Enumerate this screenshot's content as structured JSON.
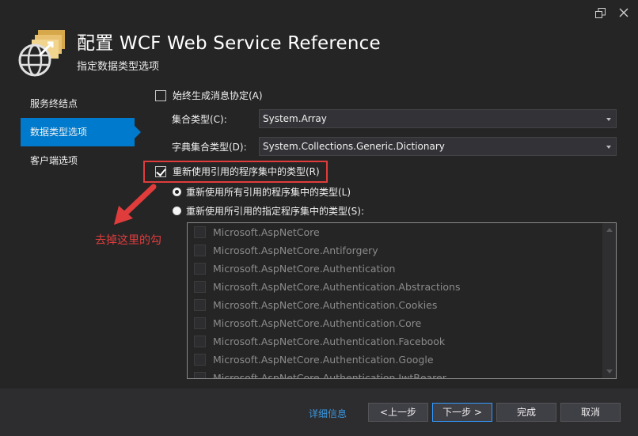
{
  "window": {
    "title": "配置 WCF Web Service Reference",
    "subtitle": "指定数据类型选项"
  },
  "titlebar": {
    "restore_icon": "restore-icon",
    "close_icon": "close-icon"
  },
  "nav": {
    "items": [
      {
        "label": "服务终结点",
        "active": false
      },
      {
        "label": "数据类型选项",
        "active": true
      },
      {
        "label": "客户端选项",
        "active": false
      }
    ]
  },
  "options": {
    "always_generate_msg": {
      "label": "始终生成消息协定(A)",
      "checked": false
    },
    "collection_type": {
      "label": "集合类型(C):",
      "value": "System.Array"
    },
    "dictionary_type": {
      "label": "字典集合类型(D):",
      "value": "System.Collections.Generic.Dictionary"
    },
    "reuse_types": {
      "label": "重新使用引用的程序集中的类型(R)",
      "checked": true
    },
    "reuse_all": {
      "label": "重新使用所有引用的程序集中的类型(L)",
      "selected": true
    },
    "reuse_specified": {
      "label": "重新使用所引用的指定程序集中的类型(S):",
      "selected": false
    }
  },
  "annotation": {
    "text": "去掉这里的勾",
    "color": "#e03c3c"
  },
  "assemblies": [
    "Microsoft.AspNetCore",
    "Microsoft.AspNetCore.Antiforgery",
    "Microsoft.AspNetCore.Authentication",
    "Microsoft.AspNetCore.Authentication.Abstractions",
    "Microsoft.AspNetCore.Authentication.Cookies",
    "Microsoft.AspNetCore.Authentication.Core",
    "Microsoft.AspNetCore.Authentication.Facebook",
    "Microsoft.AspNetCore.Authentication.Google",
    "Microsoft.AspNetCore.Authentication.JwtBearer"
  ],
  "footer": {
    "details": "详细信息",
    "prev": "<上一步",
    "next": "下一步 >",
    "finish": "完成",
    "cancel": "取消"
  },
  "colors": {
    "accent": "#007acc",
    "background": "#252526",
    "annotation": "#e03c3c"
  }
}
